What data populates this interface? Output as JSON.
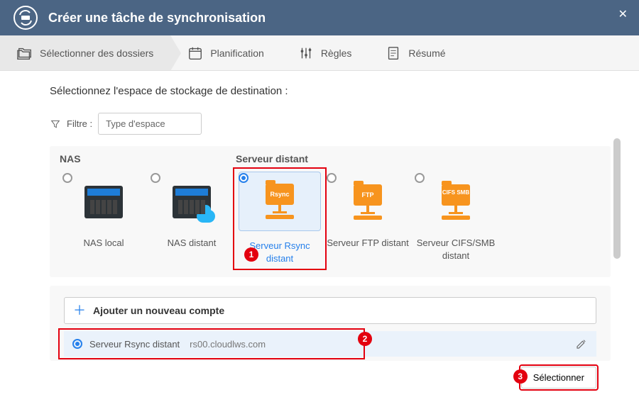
{
  "header": {
    "title": "Créer une tâche de synchronisation"
  },
  "steps": {
    "folders": "Sélectionner des dossiers",
    "schedule": "Planification",
    "rules": "Règles",
    "summary": "Résumé"
  },
  "subtitle": "Sélectionnez l'espace de stockage de destination :",
  "filter": {
    "label": "Filtre :",
    "placeholder": "Type d'espace"
  },
  "groups": {
    "nas": "NAS",
    "remote": "Serveur distant"
  },
  "destinations": {
    "nas_local": "NAS local",
    "nas_remote": "NAS distant",
    "rsync": "Serveur Rsync distant",
    "ftp": "Serveur FTP distant",
    "cifs": "Serveur CIFS/SMB distant"
  },
  "icon_labels": {
    "rsync": "Rsync",
    "ftp": "FTP",
    "cifs": "CIFS SMB"
  },
  "accounts": {
    "add": "Ajouter un nouveau compte",
    "row": {
      "type": "Serveur Rsync distant",
      "host": "rs00.cloudlws.com"
    }
  },
  "select_button": "Sélectionner",
  "badges": {
    "b1": "1",
    "b2": "2",
    "b3": "3"
  }
}
